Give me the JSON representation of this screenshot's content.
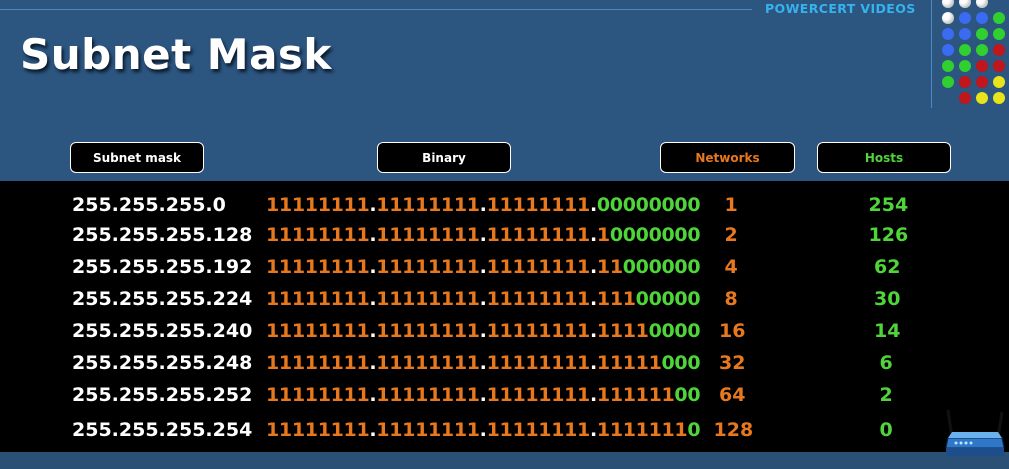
{
  "brand": "POWERCERT VIDEOS",
  "title": "Subnet Mask",
  "headers": {
    "mask": "Subnet mask",
    "binary": "Binary",
    "networks": "Networks",
    "hosts": "Hosts"
  },
  "colors": {
    "background": "#2c5580",
    "one_bits": "#e8781e",
    "zero_bits": "#4fd43a",
    "networks": "#e8781e",
    "hosts": "#4fd43a",
    "mask": "#ffffff"
  },
  "rows": [
    {
      "mask": "255.255.255.0",
      "ones": "11111111.11111111.11111111.",
      "zeros": "00000000",
      "networks": "1",
      "hosts": "254"
    },
    {
      "mask": "255.255.255.128",
      "ones": "11111111.11111111.11111111.1",
      "zeros": "0000000",
      "networks": "2",
      "hosts": "126"
    },
    {
      "mask": "255.255.255.192",
      "ones": "11111111.11111111.11111111.11",
      "zeros": "000000",
      "networks": "4",
      "hosts": "62"
    },
    {
      "mask": "255.255.255.224",
      "ones": "11111111.11111111.11111111.111",
      "zeros": "00000",
      "networks": "8",
      "hosts": "30"
    },
    {
      "mask": "255.255.255.240",
      "ones": "11111111.11111111.11111111.1111",
      "zeros": "0000",
      "networks": "16",
      "hosts": "14"
    },
    {
      "mask": "255.255.255.248",
      "ones": "11111111.11111111.11111111.11111",
      "zeros": "000",
      "networks": "32",
      "hosts": "6"
    },
    {
      "mask": "255.255.255.252",
      "ones": "11111111.11111111.11111111.111111",
      "zeros": "00",
      "networks": "64",
      "hosts": "2"
    },
    {
      "mask": "255.255.255.254",
      "ones": "11111111.11111111.11111111.1111111",
      "zeros": "0",
      "networks": "128",
      "hosts": "0"
    }
  ],
  "icons": {
    "dot_grid": "dot-grid-icon",
    "router": "router-icon"
  }
}
